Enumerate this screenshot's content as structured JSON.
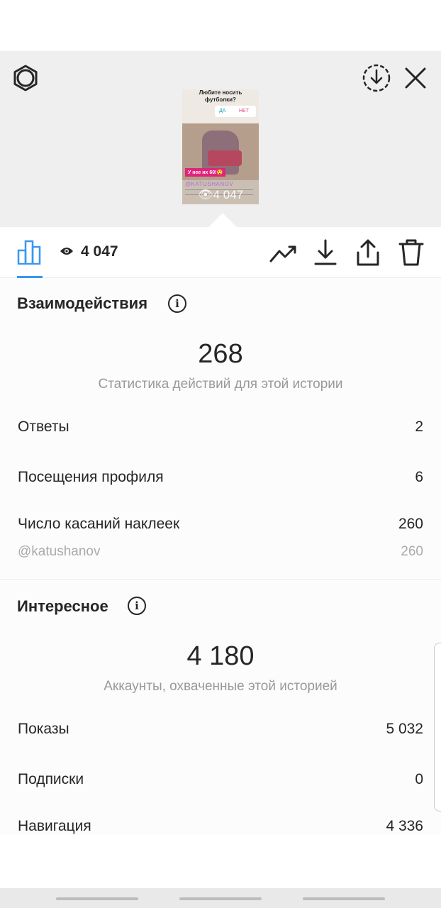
{
  "header": {
    "settings_icon": "gear-icon",
    "save_icon": "circle-download-icon",
    "close_icon": "close-icon"
  },
  "story_preview": {
    "question": "Любите носить футболки?",
    "poll_yes": "ДА",
    "poll_no": "НЕТ",
    "sticker_text": "У нее их 60!😲",
    "mention": "@KATUSHANOV",
    "views_overlay": "4 047"
  },
  "toolbar": {
    "views": "4 047",
    "active_tab_icon": "bar-chart-icon",
    "accent_color": "#3897f0",
    "action_icons": [
      "trend-icon",
      "download-icon",
      "share-icon",
      "trash-icon"
    ]
  },
  "interactions": {
    "title": "Взаимодействия",
    "total": "268",
    "caption": "Статистика действий для этой истории",
    "rows": [
      {
        "label": "Ответы",
        "value": "2"
      },
      {
        "label": "Посещения профиля",
        "value": "6"
      },
      {
        "label": "Число касаний наклеек",
        "value": "260"
      },
      {
        "label": "@katushanov",
        "value": "260"
      }
    ]
  },
  "discovery": {
    "title": "Интересное",
    "total": "4 180",
    "caption": "Аккаунты, охваченные этой историей",
    "rows": [
      {
        "label": "Показы",
        "value": "5 032"
      },
      {
        "label": "Подписки",
        "value": "0"
      },
      {
        "label": "Навигация",
        "value": "4 336"
      }
    ]
  }
}
